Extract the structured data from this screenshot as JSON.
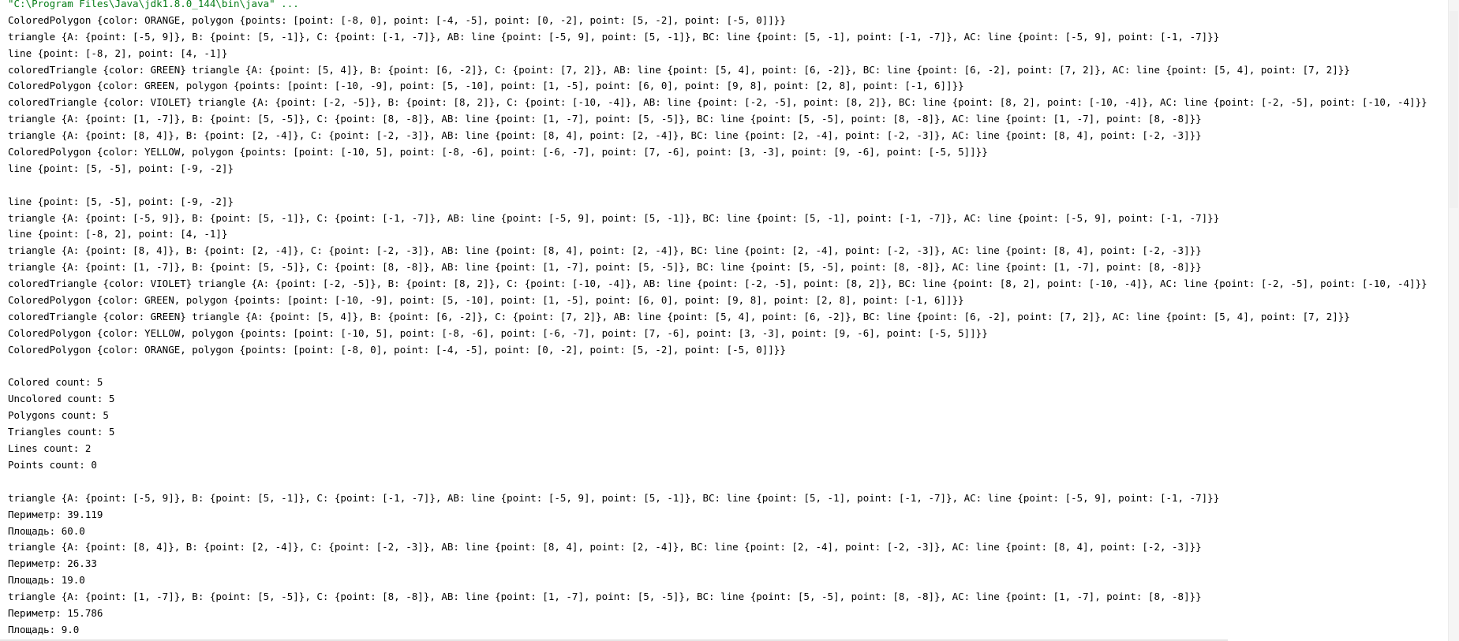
{
  "console": {
    "lines": [
      "\"C:\\Program Files\\Java\\jdk1.8.0_144\\bin\\java\" ...",
      "ColoredPolygon {color: ORANGE, polygon {points: [point: [-8, 0], point: [-4, -5], point: [0, -2], point: [5, -2], point: [-5, 0]]}}",
      "triangle {A: {point: [-5, 9]}, B: {point: [5, -1]}, C: {point: [-1, -7]}, AB: line {point: [-5, 9], point: [5, -1]}, BC: line {point: [5, -1], point: [-1, -7]}, AC: line {point: [-5, 9], point: [-1, -7]}}",
      "line {point: [-8, 2], point: [4, -1]}",
      "coloredTriangle {color: GREEN} triangle {A: {point: [5, 4]}, B: {point: [6, -2]}, C: {point: [7, 2]}, AB: line {point: [5, 4], point: [6, -2]}, BC: line {point: [6, -2], point: [7, 2]}, AC: line {point: [5, 4], point: [7, 2]}}",
      "ColoredPolygon {color: GREEN, polygon {points: [point: [-10, -9], point: [5, -10], point: [1, -5], point: [6, 0], point: [9, 8], point: [2, 8], point: [-1, 6]]}}",
      "coloredTriangle {color: VIOLET} triangle {A: {point: [-2, -5]}, B: {point: [8, 2]}, C: {point: [-10, -4]}, AB: line {point: [-2, -5], point: [8, 2]}, BC: line {point: [8, 2], point: [-10, -4]}, AC: line {point: [-2, -5], point: [-10, -4]}}",
      "triangle {A: {point: [1, -7]}, B: {point: [5, -5]}, C: {point: [8, -8]}, AB: line {point: [1, -7], point: [5, -5]}, BC: line {point: [5, -5], point: [8, -8]}, AC: line {point: [1, -7], point: [8, -8]}}",
      "triangle {A: {point: [8, 4]}, B: {point: [2, -4]}, C: {point: [-2, -3]}, AB: line {point: [8, 4], point: [2, -4]}, BC: line {point: [2, -4], point: [-2, -3]}, AC: line {point: [8, 4], point: [-2, -3]}}",
      "ColoredPolygon {color: YELLOW, polygon {points: [point: [-10, 5], point: [-8, -6], point: [-6, -7], point: [7, -6], point: [3, -3], point: [9, -6], point: [-5, 5]]}}",
      "line {point: [5, -5], point: [-9, -2]}",
      "",
      "line {point: [5, -5], point: [-9, -2]}",
      "triangle {A: {point: [-5, 9]}, B: {point: [5, -1]}, C: {point: [-1, -7]}, AB: line {point: [-5, 9], point: [5, -1]}, BC: line {point: [5, -1], point: [-1, -7]}, AC: line {point: [-5, 9], point: [-1, -7]}}",
      "line {point: [-8, 2], point: [4, -1]}",
      "triangle {A: {point: [8, 4]}, B: {point: [2, -4]}, C: {point: [-2, -3]}, AB: line {point: [8, 4], point: [2, -4]}, BC: line {point: [2, -4], point: [-2, -3]}, AC: line {point: [8, 4], point: [-2, -3]}}",
      "triangle {A: {point: [1, -7]}, B: {point: [5, -5]}, C: {point: [8, -8]}, AB: line {point: [1, -7], point: [5, -5]}, BC: line {point: [5, -5], point: [8, -8]}, AC: line {point: [1, -7], point: [8, -8]}}",
      "coloredTriangle {color: VIOLET} triangle {A: {point: [-2, -5]}, B: {point: [8, 2]}, C: {point: [-10, -4]}, AB: line {point: [-2, -5], point: [8, 2]}, BC: line {point: [8, 2], point: [-10, -4]}, AC: line {point: [-2, -5], point: [-10, -4]}}",
      "ColoredPolygon {color: GREEN, polygon {points: [point: [-10, -9], point: [5, -10], point: [1, -5], point: [6, 0], point: [9, 8], point: [2, 8], point: [-1, 6]]}}",
      "coloredTriangle {color: GREEN} triangle {A: {point: [5, 4]}, B: {point: [6, -2]}, C: {point: [7, 2]}, AB: line {point: [5, 4], point: [6, -2]}, BC: line {point: [6, -2], point: [7, 2]}, AC: line {point: [5, 4], point: [7, 2]}}",
      "ColoredPolygon {color: YELLOW, polygon {points: [point: [-10, 5], point: [-8, -6], point: [-6, -7], point: [7, -6], point: [3, -3], point: [9, -6], point: [-5, 5]]}}",
      "ColoredPolygon {color: ORANGE, polygon {points: [point: [-8, 0], point: [-4, -5], point: [0, -2], point: [5, -2], point: [-5, 0]]}}",
      "",
      "Colored count: 5",
      "Uncolored count: 5",
      "Polygons count: 5",
      "Triangles count: 5",
      "Lines count: 2",
      "Points count: 0",
      "",
      "triangle {A: {point: [-5, 9]}, B: {point: [5, -1]}, C: {point: [-1, -7]}, AB: line {point: [-5, 9], point: [5, -1]}, BC: line {point: [5, -1], point: [-1, -7]}, AC: line {point: [-5, 9], point: [-1, -7]}}",
      "Периметр: 39.119",
      "Площадь: 60.0",
      "triangle {A: {point: [8, 4]}, B: {point: [2, -4]}, C: {point: [-2, -3]}, AB: line {point: [8, 4], point: [2, -4]}, BC: line {point: [2, -4], point: [-2, -3]}, AC: line {point: [8, 4], point: [-2, -3]}}",
      "Периметр: 26.33",
      "Площадь: 19.0",
      "triangle {A: {point: [1, -7]}, B: {point: [5, -5]}, C: {point: [8, -8]}, AB: line {point: [1, -7], point: [5, -5]}, BC: line {point: [5, -5], point: [8, -8]}, AC: line {point: [1, -7], point: [8, -8]}}",
      "Периметр: 15.786",
      "Площадь: 9.0"
    ]
  },
  "colors": {
    "background": "#ffffff",
    "text": "#000000",
    "command_text": "#067d17"
  }
}
